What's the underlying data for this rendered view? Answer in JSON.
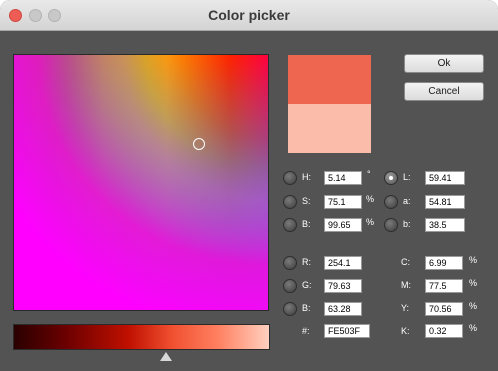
{
  "window": {
    "title": "Color picker"
  },
  "buttons": {
    "ok": "Ok",
    "cancel": "Cancel"
  },
  "colors": {
    "new": "#EE6550",
    "current": "#FBBDAA"
  },
  "hsb": {
    "h": {
      "label": "H:",
      "value": "5.14",
      "unit": "°"
    },
    "s": {
      "label": "S:",
      "value": "75.1",
      "unit": "%"
    },
    "b": {
      "label": "B:",
      "value": "99.65",
      "unit": "%"
    }
  },
  "lab": {
    "l": {
      "label": "L:",
      "value": "59.41"
    },
    "a": {
      "label": "a:",
      "value": "54.81"
    },
    "b": {
      "label": "b:",
      "value": "38.5"
    }
  },
  "rgb": {
    "r": {
      "label": "R:",
      "value": "254.1"
    },
    "g": {
      "label": "G:",
      "value": "79.63"
    },
    "b": {
      "label": "B:",
      "value": "63.28"
    }
  },
  "hex": {
    "label": "#:",
    "value": "FE503F"
  },
  "cmyk": {
    "c": {
      "label": "C:",
      "value": "6.99",
      "unit": "%"
    },
    "m": {
      "label": "M:",
      "value": "77.5",
      "unit": "%"
    },
    "y": {
      "label": "Y:",
      "value": "70.56",
      "unit": "%"
    },
    "k": {
      "label": "K:",
      "value": "0.32",
      "unit": "%"
    }
  },
  "selected_mode": "L"
}
